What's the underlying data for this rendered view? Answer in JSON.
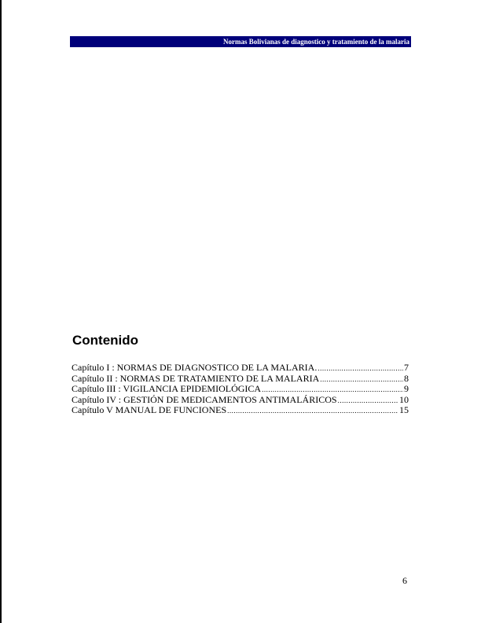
{
  "header": {
    "title": "Normas Bolivianas de diagnostico y tratamiento de la malaria"
  },
  "toc": {
    "heading": "Contenido",
    "entries": [
      {
        "title": "Capítulo I : NORMAS DE DIAGNOSTICO DE LA MALARIA.",
        "page": "7"
      },
      {
        "title": "Capítulo II : NORMAS DE TRATAMIENTO DE LA MALARIA",
        "page": "8"
      },
      {
        "title": "Capítulo III : VIGILANCIA EPIDEMIOLÓGICA",
        "page": "9"
      },
      {
        "title": "Capítulo IV : GESTIÓN DE MEDICAMENTOS ANTIMALÁRICOS",
        "page": "10"
      },
      {
        "title": "Capítulo V MANUAL DE FUNCIONES",
        "page": "15"
      }
    ]
  },
  "footer": {
    "page_number": "6"
  }
}
